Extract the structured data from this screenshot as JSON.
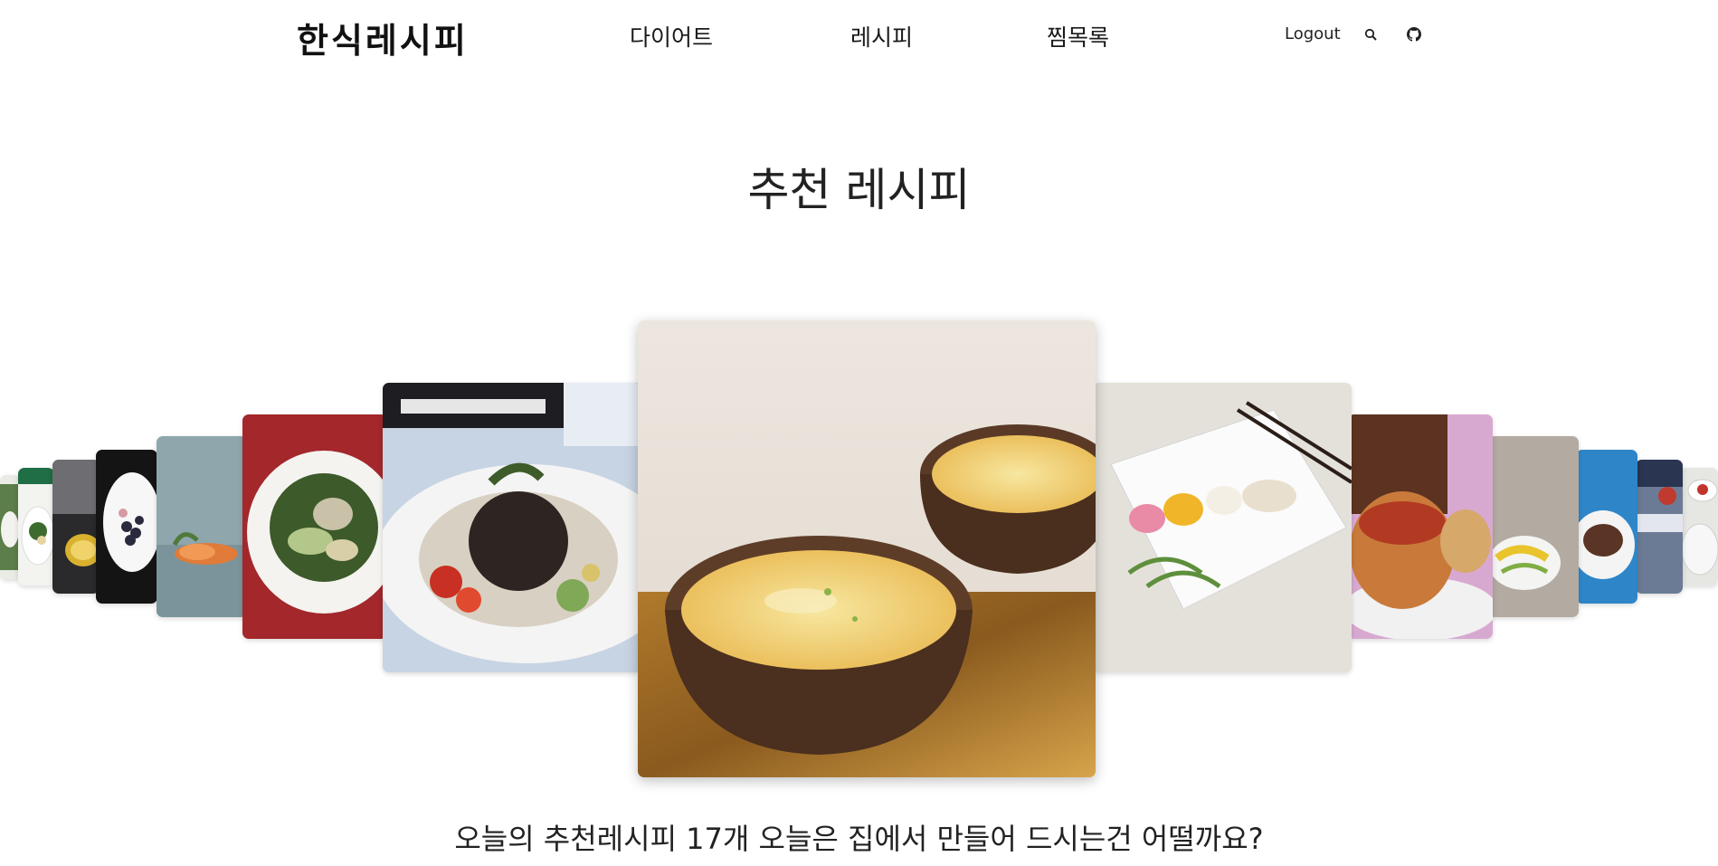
{
  "header": {
    "logo": "한식레시피",
    "nav": {
      "diet": "다이어트",
      "recipe": "레시피",
      "favorites": "찜목록"
    },
    "logout": "Logout",
    "icons": {
      "search": "search-icon",
      "github": "github-icon"
    }
  },
  "main": {
    "title": "추천 레시피",
    "subtitle": "오늘의 추천레시피 17개 오늘은 집에서 만들어 드시는건 어떨까요?"
  },
  "carousel": {
    "slide_count": 14,
    "slides": [
      "green-salad-plate",
      "white-plate-salad",
      "black-bowl-dish",
      "white-bowl-berries",
      "carrot-on-blue",
      "white-bowl-greens",
      "black-noodle-salad",
      "egg-custard-bowls",
      "plated-cold-noodle-garnish",
      "bread-bowl-stew",
      "egg-roll-plate",
      "steak-blue-plate",
      "plaid-cloth-dish",
      "red-sauce-plate"
    ]
  }
}
